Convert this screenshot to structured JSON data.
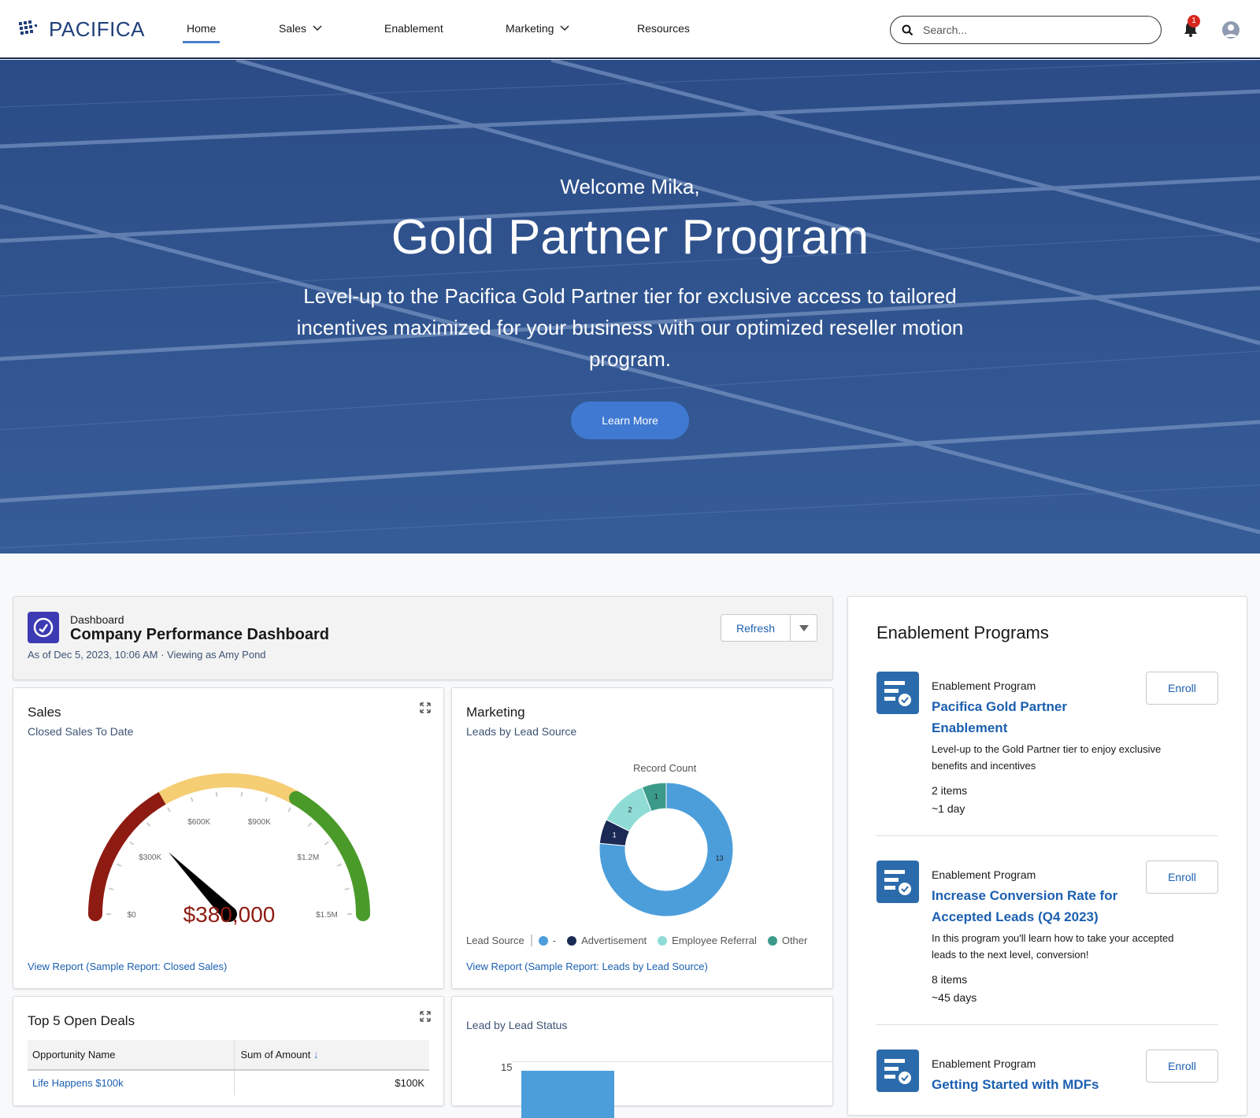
{
  "nav": {
    "brand": "PACIFICA",
    "items": [
      {
        "label": "Home",
        "active": true
      },
      {
        "label": "Sales",
        "dropdown": true
      },
      {
        "label": "Enablement"
      },
      {
        "label": "Marketing",
        "dropdown": true
      },
      {
        "label": "Resources"
      }
    ],
    "search_placeholder": "Search...",
    "notification_count": "1"
  },
  "hero": {
    "welcome": "Welcome Mika,",
    "title": "Gold Partner Program",
    "description": "Level-up to the Pacifica Gold Partner tier for exclusive access to tailored incentives maximized for your business with our optimized reseller motion program.",
    "cta": "Learn More"
  },
  "dashboard": {
    "kind": "Dashboard",
    "title": "Company Performance Dashboard",
    "meta": "As of Dec 5, 2023, 10:06 AM · Viewing as Amy Pond",
    "refresh": "Refresh"
  },
  "sales": {
    "title": "Sales",
    "subtitle": "Closed Sales To Date",
    "value_label": "$380,000",
    "link": "View Report (Sample Report: Closed Sales)",
    "chart_data": {
      "type": "gauge",
      "value": 380000,
      "min": 0,
      "max": 1500000,
      "ticks": [
        "$0",
        "$300K",
        "$600K",
        "$900K",
        "$1.2M",
        "$1.5M"
      ],
      "bands": [
        {
          "to": 500000,
          "color": "#8e1b12"
        },
        {
          "to": 1000000,
          "color": "#f5cd73"
        },
        {
          "to": 1500000,
          "color": "#4a9a2a"
        }
      ]
    }
  },
  "marketing": {
    "title": "Marketing",
    "subtitle": "Leads by Lead Source",
    "link": "View Report (Sample Report: Leads by Lead Source)",
    "chart_data": {
      "type": "donut",
      "title": "Record Count",
      "legend_title": "Lead Source",
      "legend": "bottom",
      "categories": [
        "-",
        "Advertisement",
        "Employee Referral",
        "Other"
      ],
      "values": [
        13,
        1,
        2,
        1
      ],
      "colors": [
        "#4c9edb",
        "#1a2a54",
        "#8fdcd6",
        "#3c9a8a"
      ]
    }
  },
  "deals": {
    "title": "Top 5 Open Deals",
    "columns": [
      "Opportunity Name",
      "Sum of Amount"
    ],
    "rows": [
      [
        "Life Happens $100k",
        "$100K"
      ]
    ]
  },
  "lead_status": {
    "title": "Lead by Lead Status",
    "chart_data": {
      "type": "bar",
      "yticks": [
        15
      ],
      "values": [
        14
      ]
    }
  },
  "enablement": {
    "title": "Enablement Programs",
    "programs": [
      {
        "kind": "Enablement Program",
        "title": "Pacifica Gold Partner Enablement",
        "description": "Level-up to the Gold Partner tier to enjoy exclusive benefits and incentives",
        "items": "2 items",
        "duration": "~1 day",
        "enroll": "Enroll"
      },
      {
        "kind": "Enablement Program",
        "title": "Increase Conversion Rate for Accepted Leads (Q4 2023)",
        "description": "In this program you'll learn how to take your accepted leads to the next level, conversion!",
        "items": "8 items",
        "duration": "~45 days",
        "enroll": "Enroll"
      },
      {
        "kind": "Enablement Program",
        "title": "Getting Started with MDFs",
        "enroll": "Enroll"
      }
    ]
  }
}
